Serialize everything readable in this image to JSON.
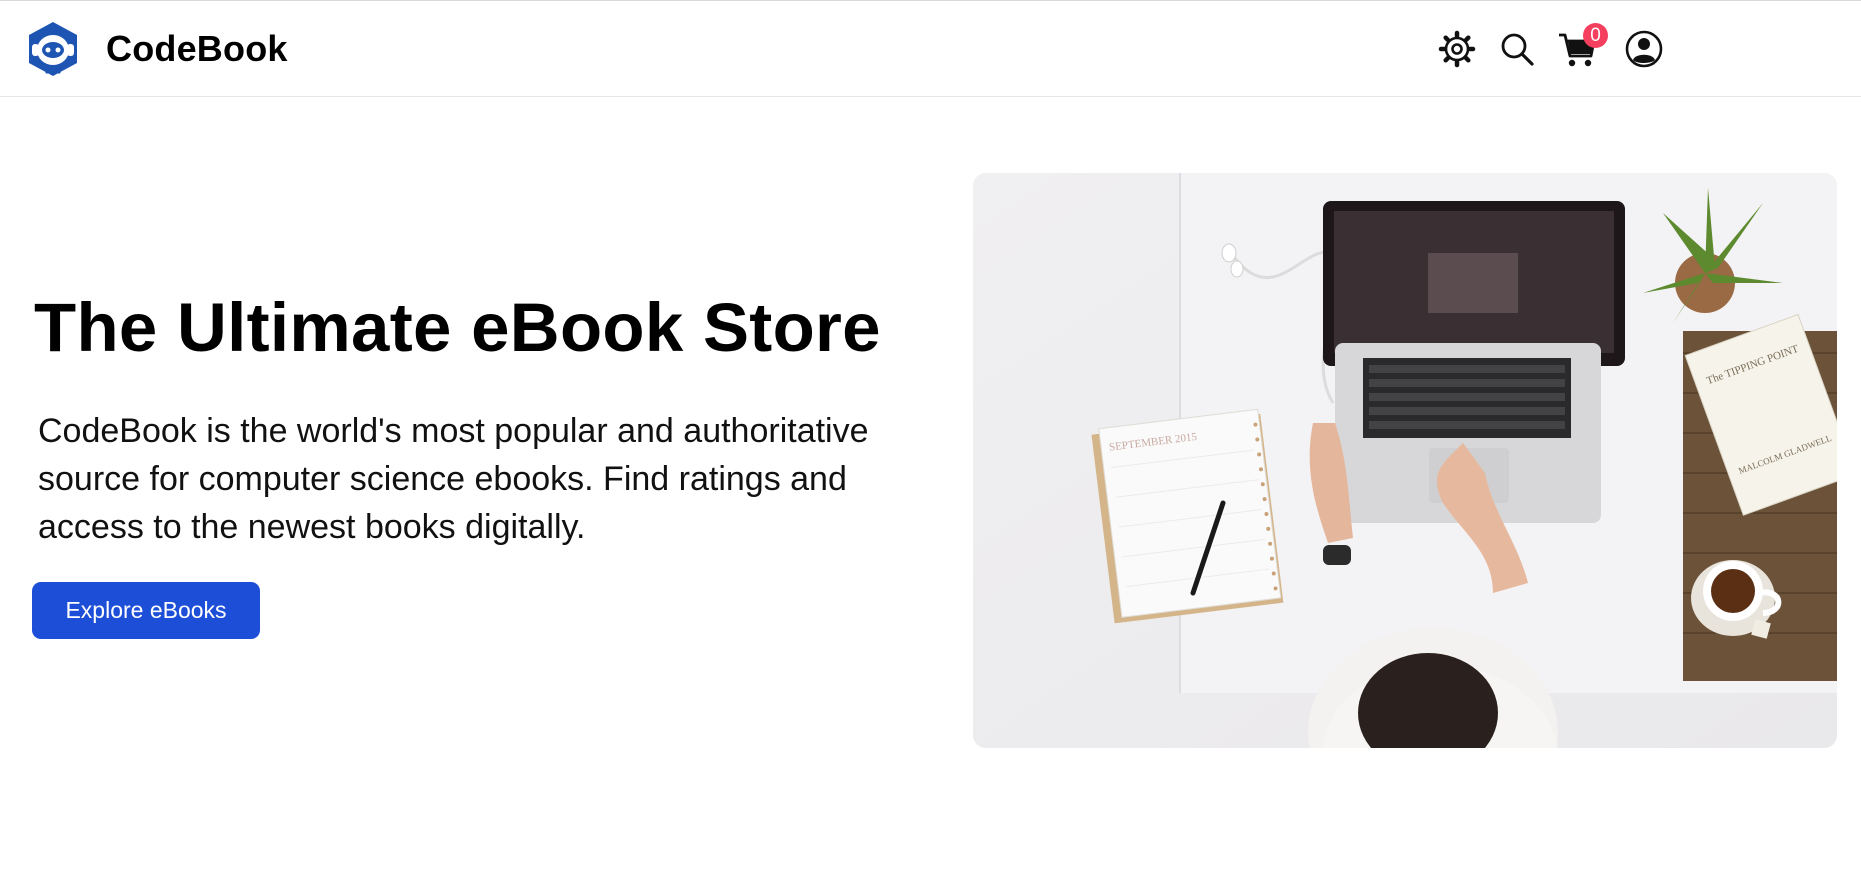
{
  "brand": {
    "name": "CodeBook",
    "logo_icon": "robot-hexagon-logo",
    "color": "#1e55b3"
  },
  "header": {
    "icons": [
      "settings-gear-icon",
      "search-icon",
      "cart-icon",
      "user-account-icon"
    ],
    "cart_count": "0",
    "badge_color": "#f43f5e"
  },
  "hero": {
    "title": "The Ultimate eBook Store",
    "description": "CodeBook is the world's most popular and authoritative source for computer science ebooks. Find ratings and access to the newest books digitally.",
    "cta_label": "Explore eBooks",
    "cta_color": "#1d4ed8",
    "image_alt": "Person working on a laptop at a white desk with a calendar, plant, books and tea",
    "image_details": {
      "calendar_text": "SEPTEMBER 2015",
      "book_text": "The TIPPING POINT",
      "book_author": "MALCOLM GLADWELL"
    }
  }
}
